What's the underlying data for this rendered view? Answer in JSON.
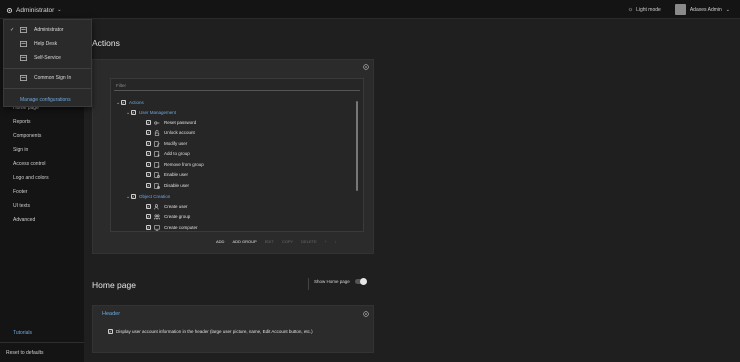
{
  "header": {
    "app_title": "Administrator",
    "light_mode_label": "Light mode",
    "user_name": "Adaxes Admin"
  },
  "app_switcher": {
    "items": [
      {
        "label": "Administrator",
        "selected": true
      },
      {
        "label": "Help Desk",
        "selected": false
      },
      {
        "label": "Self-Service",
        "selected": false
      },
      {
        "label": "Common Sign In",
        "selected": false
      }
    ],
    "manage_label": "Manage configurations"
  },
  "sidebar": {
    "items": [
      {
        "label": "Home page"
      },
      {
        "label": "Reports"
      },
      {
        "label": "Components"
      },
      {
        "label": "Sign in"
      },
      {
        "label": "Access control"
      },
      {
        "label": "Logo and colors"
      },
      {
        "label": "Footer"
      },
      {
        "label": "UI texts"
      },
      {
        "label": "Advanced"
      }
    ],
    "tutorials_label": "Tutorials",
    "reset_label": "Reset to defaults"
  },
  "actions_section": {
    "title": "Actions",
    "filter_placeholder": "Filter",
    "tree": {
      "root_label": "Actions",
      "groups": [
        {
          "label": "User Management",
          "items": [
            {
              "label": "Reset password",
              "icon": "key-icon"
            },
            {
              "label": "Unlock account",
              "icon": "unlock-icon"
            },
            {
              "label": "Modify user",
              "icon": "edit-user-icon"
            },
            {
              "label": "Add to group",
              "icon": "add-to-group-icon"
            },
            {
              "label": "Remove from group",
              "icon": "remove-from-group-icon"
            },
            {
              "label": "Enable user",
              "icon": "enable-user-icon"
            },
            {
              "label": "Disable user",
              "icon": "disable-user-icon"
            }
          ]
        },
        {
          "label": "Object Creation",
          "items": [
            {
              "label": "Create user",
              "icon": "create-user-icon"
            },
            {
              "label": "Create group",
              "icon": "create-group-icon"
            },
            {
              "label": "Create computer",
              "icon": "create-computer-icon"
            }
          ]
        }
      ]
    },
    "buttons": {
      "add": "ADD",
      "add_group": "ADD GROUP",
      "edit": "EDIT",
      "copy": "COPY",
      "delete": "DELETE",
      "up": "↑",
      "down": "↓"
    }
  },
  "home_section": {
    "title": "Home page",
    "toggle_label": "Show Home page",
    "toggle_on": true,
    "header_panel_title": "Header",
    "display_user_info_label": "Display user account information in the header (large user picture, name, Edit Account button, etc.)"
  },
  "colors": {
    "accent": "#6fa8dc",
    "background": "#1f1f1f",
    "panel": "#2b2b2b",
    "sidebar": "#141414"
  }
}
